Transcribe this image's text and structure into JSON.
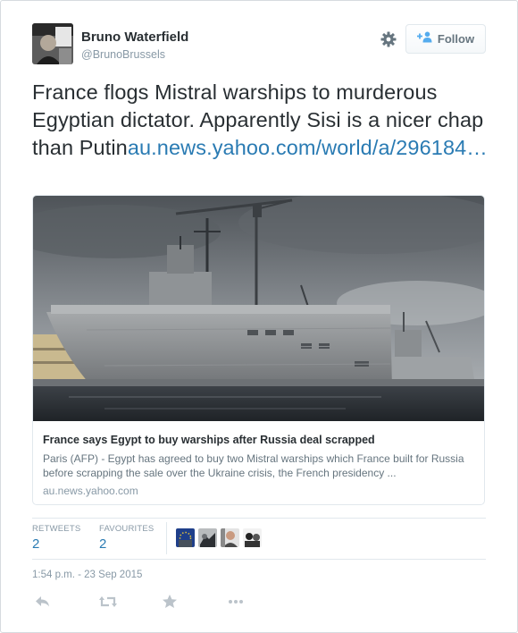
{
  "user": {
    "name": "Bruno Waterfield",
    "handle": "@BrunoBrussels"
  },
  "follow": {
    "label": "Follow"
  },
  "tweet": {
    "text": "France flogs Mistral warships to murderous Egyptian dictator. Apparently Sisi is a nicer chap than Putin",
    "link": "au.news.yahoo.com/world/a/296184…"
  },
  "card": {
    "title": "France says Egypt to buy warships after Russia deal scrapped",
    "description": "Paris (AFP) - Egypt has agreed to buy two Mistral warships which France built for Russia before scrapping the sale over the Ukraine crisis, the French presidency ...",
    "domain": "au.news.yahoo.com"
  },
  "stats": {
    "retweets_label": "RETWEETS",
    "retweets": "2",
    "favourites_label": "FAVOURITES",
    "favourites": "2"
  },
  "timestamp": "1:54 p.m. - 23 Sep 2015",
  "icons": {
    "settings": "gear-icon",
    "follow": "add-person-icon",
    "reply": "reply-icon",
    "retweet": "retweet-icon",
    "favourite": "star-icon",
    "more": "more-icon"
  },
  "colors": {
    "link": "#2a7bb3",
    "muted": "#8899a6",
    "text": "#292f33",
    "border": "#e1e8ed"
  }
}
